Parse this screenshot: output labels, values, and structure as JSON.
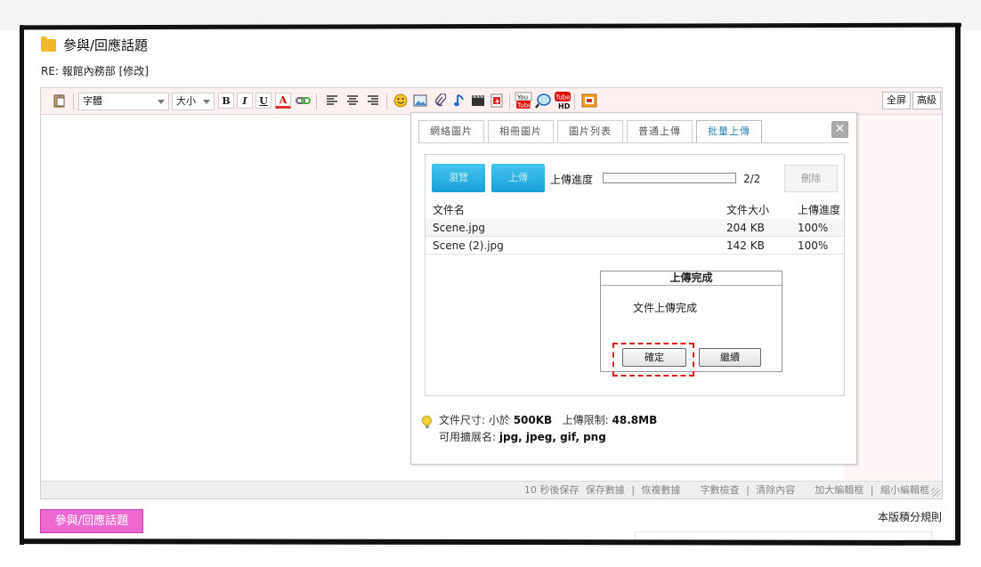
{
  "page": {
    "title": "參與/回應話題",
    "subject": "RE: 報館內務部 [修改]"
  },
  "toolbar": {
    "font_select": "字體",
    "size_select": "大小",
    "bold": "B",
    "italic": "I",
    "underline": "U",
    "font_color": "A",
    "fullscreen": "全屏",
    "advanced": "高級"
  },
  "status_bar": {
    "autosave": "10 秒後保存",
    "links": [
      "保存數據",
      "恢複數據",
      "字數檢查",
      "清除內容",
      "加大編輯框",
      "縮小編輯框"
    ]
  },
  "dialog": {
    "tabs": [
      "網絡圖片",
      "相冊圖片",
      "圖片列表",
      "普通上傳",
      "批量上傳"
    ],
    "active_tab": "批量上傳",
    "browse_button": "瀏覽",
    "upload_button": "上傳",
    "progress_label": "上傳進度",
    "progress_count": "2/2",
    "progress_fraction": 0,
    "delete_button": "刪除",
    "table": {
      "headers": [
        "文件名",
        "文件大小",
        "上傳進度"
      ],
      "rows": [
        {
          "name": "Scene.jpg",
          "size": "204 KB",
          "progress": "100%"
        },
        {
          "name": "Scene (2).jpg",
          "size": "142 KB",
          "progress": "100%"
        }
      ]
    },
    "message_box": {
      "title": "上傳完成",
      "text": "文件上傳完成",
      "ok_button": "確定",
      "continue_button": "繼續"
    },
    "tip": {
      "size_label": "文件尺寸: 小於",
      "size_value": "500KB",
      "limit_label": "上傳限制:",
      "limit_value": "48.8MB",
      "ext_label": "可用擴展名:",
      "ext_value": "jpg, jpeg, gif, png"
    }
  },
  "footer": {
    "submit_button": "參與/回應話題",
    "rules_link": "本版積分規則"
  },
  "colors": {
    "accent_blue": "#1a9fd6",
    "submit_pink": "#ee6ad0",
    "highlight_red": "#e02020",
    "folder_yellow": "#f5b72c"
  }
}
